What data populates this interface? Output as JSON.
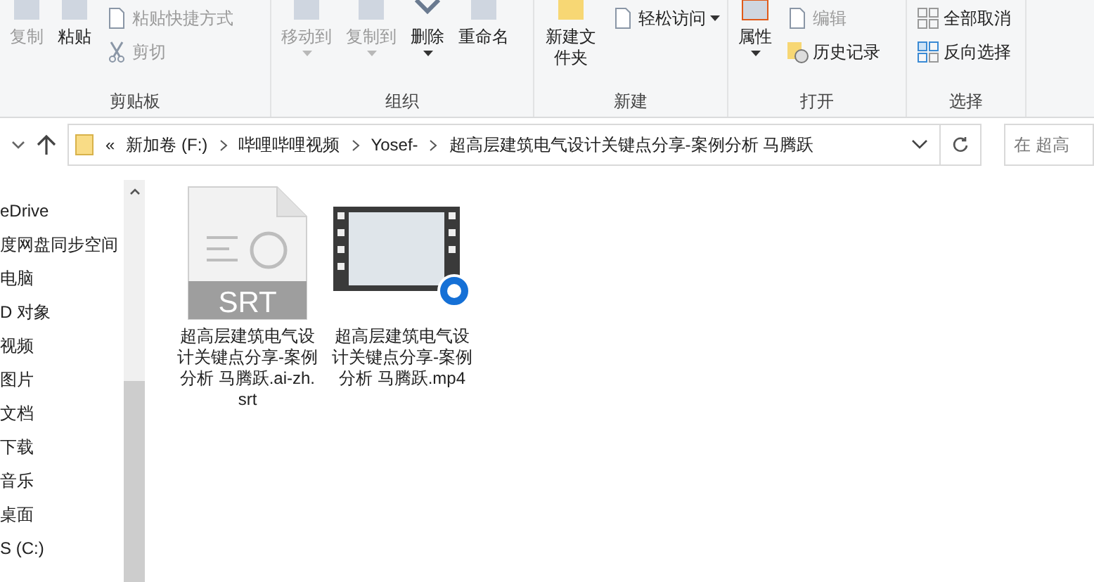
{
  "ribbon": {
    "groups": [
      {
        "label": "剪贴板",
        "items": [
          {
            "kind": "large",
            "label": "复制",
            "disabled": true
          },
          {
            "kind": "large",
            "label": "粘贴",
            "disabled": false
          },
          {
            "kind": "small",
            "label": "粘贴快捷方式",
            "disabled": true
          },
          {
            "kind": "small",
            "label": "剪切",
            "disabled": true
          }
        ]
      },
      {
        "label": "组织",
        "items": [
          {
            "kind": "large",
            "label": "移动到",
            "disabled": true,
            "dropdown": true
          },
          {
            "kind": "large",
            "label": "复制到",
            "disabled": true,
            "dropdown": true
          },
          {
            "kind": "large",
            "label": "删除",
            "disabled": false,
            "dropdown": true
          },
          {
            "kind": "large",
            "label": "重命名",
            "disabled": false
          }
        ]
      },
      {
        "label": "新建",
        "items": [
          {
            "kind": "large",
            "label": "新建文件夹",
            "disabled": false
          },
          {
            "kind": "small",
            "label": "轻松访问",
            "disabled": false,
            "dropdown": true
          }
        ]
      },
      {
        "label": "打开",
        "items": [
          {
            "kind": "large",
            "label": "属性",
            "disabled": false,
            "dropdown": true
          },
          {
            "kind": "small",
            "label": "编辑",
            "disabled": true
          },
          {
            "kind": "small",
            "label": "历史记录",
            "disabled": false
          }
        ]
      },
      {
        "label": "选择",
        "items": [
          {
            "kind": "small",
            "label": "全部取消",
            "disabled": false
          },
          {
            "kind": "small",
            "label": "反向选择",
            "disabled": false
          }
        ]
      }
    ]
  },
  "address": {
    "breadcrumbs": [
      "«",
      "新加卷 (F:)",
      "哔哩哔哩视频",
      "Yosef-",
      "超高层建筑电气设计关键点分享-案例分析 马腾跃"
    ]
  },
  "search": {
    "placeholder": "在 超高"
  },
  "sidebar": {
    "items": [
      "eDrive",
      "度网盘同步空间",
      "电脑",
      "D 对象",
      "视频",
      "图片",
      "文档",
      "下载",
      "音乐",
      "桌面",
      "S (C:)"
    ]
  },
  "files": [
    {
      "kind": "subtitle",
      "name": "超高层建筑电气设计关键点分享-案例分析 马腾跃.ai-zh.srt",
      "icon_label": "SRT"
    },
    {
      "kind": "video",
      "name": "超高层建筑电气设计关键点分享-案例分析 马腾跃.mp4"
    }
  ]
}
